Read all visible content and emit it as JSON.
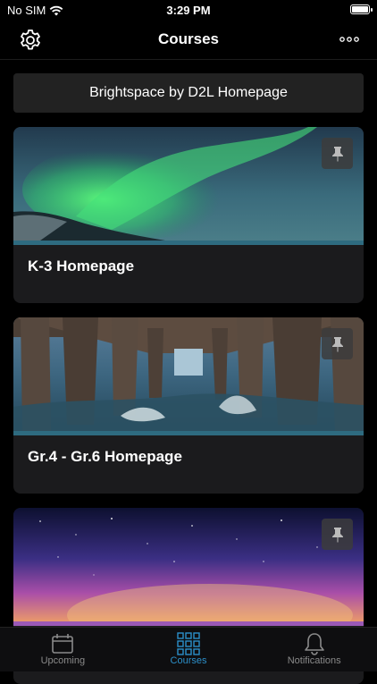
{
  "status": {
    "carrier": "No SIM",
    "time": "3:29 PM"
  },
  "nav": {
    "title": "Courses"
  },
  "banner": {
    "label": "Brightspace by D2L Homepage"
  },
  "courses": [
    {
      "title": "K-3 Homepage",
      "accent": "#2e6b80"
    },
    {
      "title": "Gr.4 - Gr.6 Homepage",
      "accent": "#2e6b80"
    },
    {
      "title": "",
      "accent": "#9b59b6"
    }
  ],
  "tabs": [
    {
      "label": "Upcoming",
      "icon": "calendar-icon",
      "active": false
    },
    {
      "label": "Courses",
      "icon": "grid-icon",
      "active": true
    },
    {
      "label": "Notifications",
      "icon": "bell-icon",
      "active": false
    }
  ],
  "colors": {
    "accent": "#2c8fc9",
    "background": "#000000",
    "card": "#1b1b1d"
  }
}
